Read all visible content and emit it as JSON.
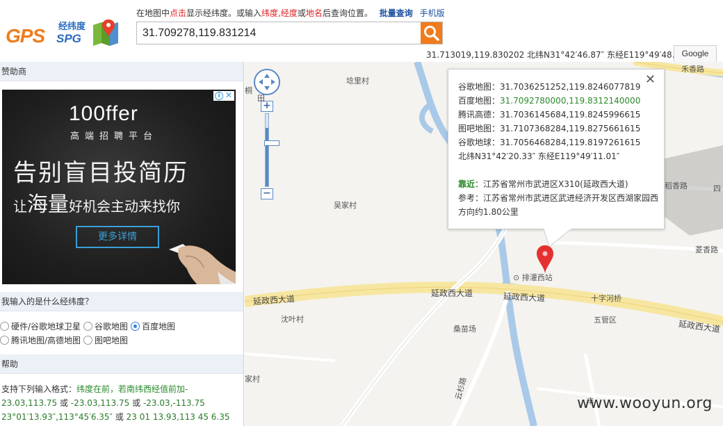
{
  "header": {
    "logo": {
      "cn": "经纬度",
      "gps": "GPS",
      "spg": "SPG"
    },
    "hint": {
      "p1": "在地图中",
      "p2": "点击",
      "p3": "显示经纬度。或输入",
      "p4": "纬度",
      "p5": ",",
      "p6": "经度",
      "p7": "或",
      "p8": "地名",
      "p9": "后查询位置。",
      "batch_link": "批量查询",
      "mobile_link": "手机版"
    },
    "search_value": "31.709278,119.831214",
    "coord_line": "31.713019,119.830202 北纬N31°42′46.87″ 东经E119°49′48.73″",
    "google_btn": "Google"
  },
  "sidebar": {
    "sponsor_title": "赞助商",
    "ad": {
      "brand": "100ffer",
      "brand_sub": "高端招聘平台",
      "line1": "告别盲目投简历",
      "line2_a": "让",
      "line2_b": "海量",
      "line2_c": "好机会主动来找你",
      "cta": "更多详情"
    },
    "question_title": "我输入的是什么经纬度？",
    "options": [
      {
        "label": "硬件/谷歌地球卫星",
        "checked": false
      },
      {
        "label": "谷歌地图",
        "checked": false
      },
      {
        "label": "百度地图",
        "checked": true
      },
      {
        "label": "腾讯地图/高德地图",
        "checked": false
      },
      {
        "label": "图吧地图",
        "checked": false
      }
    ],
    "help_title": "帮助",
    "help": {
      "intro": "支持下列输入格式：",
      "rule": "纬度在前，若南纬西经值前加-",
      "ex1a": "23.03,113.75",
      "or1": " 或 ",
      "ex1b": "-23.03,113.75",
      "or2": " 或 ",
      "ex1c": "-23.03,-113.75",
      "ex2a": "23°01′13.93″,113°45′6.35″",
      "or3": " 或 ",
      "ex2b": "23 01 13.93,113 45 6.35"
    }
  },
  "map": {
    "popup": {
      "rows": [
        {
          "label": "谷歌地图：",
          "value": "31.7036251252,119.8246077819"
        },
        {
          "label": "百度地图：",
          "value": "31.7092780000,119.8312140000"
        },
        {
          "label": "腾讯高德：",
          "value": "31.7036145684,119.8245996615"
        },
        {
          "label": "图吧地图：",
          "value": "31.7107368284,119.8275661615"
        },
        {
          "label": "谷歌地球：",
          "value": "31.7056468284,119.8197261615"
        }
      ],
      "dms": "北纬N31°42′20.33″ 东经E119°49′11.01″",
      "near_label": "靠近",
      "near_value": "：江苏省常州市武进区X310(延政西大道)",
      "ref_label": "参考：",
      "ref_value": "江苏省常州市武进区武进经济开发区西湖家园西方向约1.80公里"
    },
    "labels": {
      "laolicun": "埝里村",
      "wujiacun": "吴家村",
      "paiguanxizhan": "排灌西站",
      "shizihe": "十字河桥",
      "wuguanqu": "五管区",
      "chenyecun": "沈叶村",
      "sangmiaochang": "桑苗场",
      "yunshanlu": "云杉路",
      "ji": "桐",
      "tian": "田",
      "cun": "家村",
      "daoxiang": "稻香路",
      "si": "四",
      "lingxiang": "菱香路",
      "hexiang": "禾香路",
      "feng": "丰"
    },
    "roads": {
      "yanzheng1": "延政西大道",
      "yanzheng2": "延政西大道",
      "yanzheng3": "延政西大道",
      "yanzheng4": "延政西大道"
    }
  },
  "watermark": "www.wooyun.org"
}
